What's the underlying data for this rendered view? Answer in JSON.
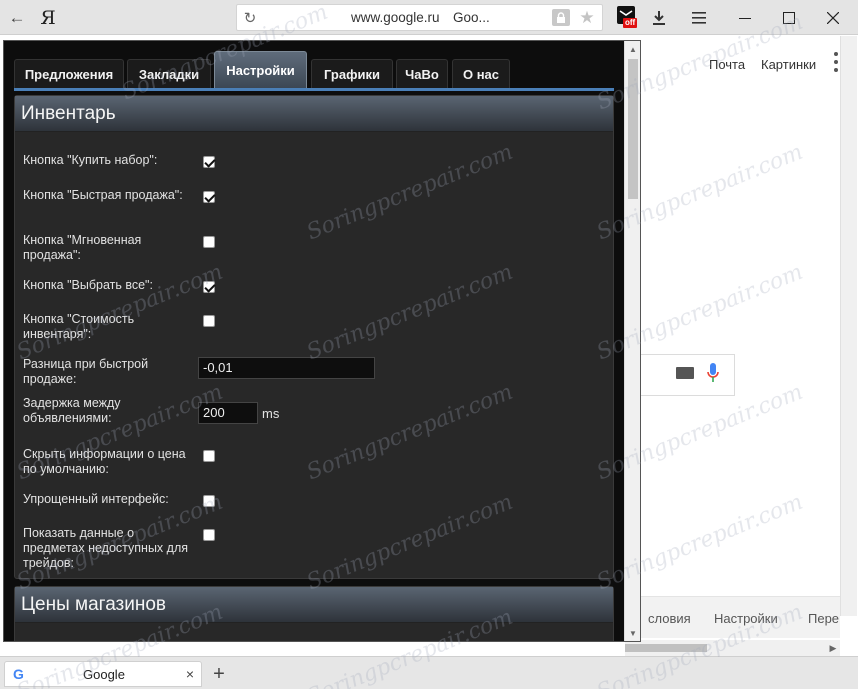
{
  "browser": {
    "back_icon": "arrow-left-icon",
    "logo": "Я",
    "url": "www.google.ru",
    "page_title_short": "Goo...",
    "extension_badge": "off",
    "tab": {
      "title": "Google",
      "close": "×"
    },
    "new_tab": "+"
  },
  "google_page": {
    "mail_link": "Почта",
    "images_link": "Картинки",
    "footer": {
      "conditions": "словия",
      "settings": "Настройки",
      "translate": "Пере"
    }
  },
  "popup": {
    "tabs": [
      "Предложения",
      "Закладки",
      "Настройки",
      "Графики",
      "ЧаВо",
      "О нас"
    ],
    "active_tab": "Настройки",
    "inventory_section": {
      "title": "Инвентарь",
      "rows": [
        {
          "label": "Кнопка \"Купить набор\":",
          "type": "checkbox",
          "checked": true
        },
        {
          "label": "Кнопка \"Быстрая продажа\":",
          "type": "checkbox",
          "checked": true
        },
        {
          "label": "Кнопка \"Мгновенная продажа\":",
          "type": "checkbox",
          "checked": false
        },
        {
          "label": "Кнопка \"Выбрать все\":",
          "type": "checkbox",
          "checked": true
        },
        {
          "label": "Кнопка \"Стоимость инвентаря\":",
          "type": "checkbox",
          "checked": false
        },
        {
          "label": "Разница при быстрой продаже:",
          "type": "text",
          "value": "-0,01"
        },
        {
          "label": "Задержка между объявлениями:",
          "type": "text",
          "value": "200",
          "unit": "ms"
        },
        {
          "label": "Скрыть информации о цена по умолчанию:",
          "type": "checkbox",
          "checked": false
        },
        {
          "label": "Упрощенный интерфейс:",
          "type": "checkbox",
          "checked": false
        },
        {
          "label": "Показать данные о предметах недоступных для трейдов:",
          "type": "checkbox",
          "checked": false
        }
      ]
    },
    "shop_section": {
      "title": "Цены магазинов"
    }
  },
  "watermark": "Soringpcrepair.com",
  "colors": {
    "tab_underline": "#4a7fb7",
    "popup_bg": "#0d0d0d",
    "section_bg": "#282828"
  }
}
